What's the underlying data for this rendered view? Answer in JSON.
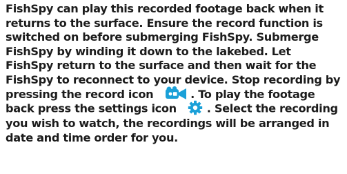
{
  "instructions": {
    "lines": [
      "FishSpy can play this recorded footage back when it",
      "returns to the surface. Ensure the record function is",
      "switched on before submerging FishSpy. Submerge",
      "FishSpy by winding it down to the lakebed. Let",
      "FishSpy return to the surface and then wait for the",
      "FishSpy to reconnect to your device. Stop recording by"
    ],
    "line7_before": "pressing the record icon",
    "line7_after": ". To play the footage",
    "line8_before": "back press the settings icon",
    "line8_after": ". Select the recording",
    "tail_lines": [
      "you wish to watch, the recordings will be arranged in",
      "date and time order for you."
    ]
  },
  "icons": {
    "record": "video-camera-record-icon",
    "settings": "gear-settings-icon"
  },
  "colors": {
    "text": "#1c1c1c",
    "icon_accent": "#1aa0d8"
  }
}
